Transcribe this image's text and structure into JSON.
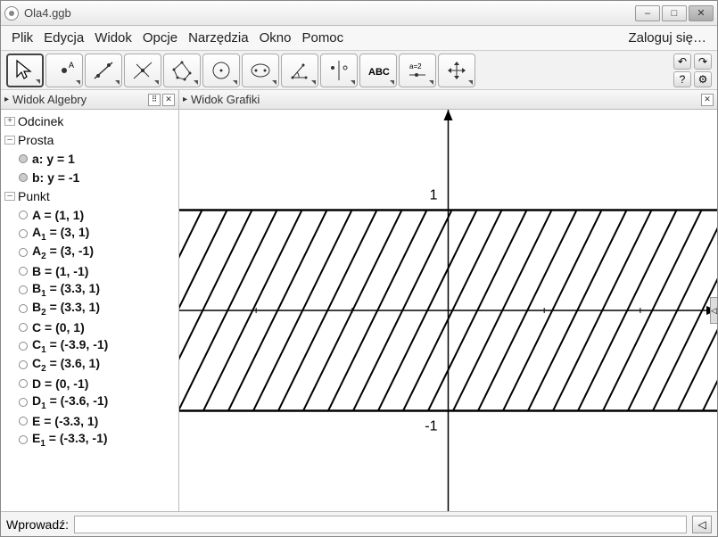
{
  "window": {
    "title": "Ola4.ggb"
  },
  "menu": {
    "items": [
      "Plik",
      "Edycja",
      "Widok",
      "Opcje",
      "Narzędzia",
      "Okno",
      "Pomoc"
    ],
    "login": "Zaloguj się…"
  },
  "panels": {
    "algebra_title": "Widok Algebry",
    "graphics_title": "Widok Grafiki"
  },
  "algebra": {
    "categories": [
      {
        "name": "Odcinek",
        "expanded": false,
        "children": []
      },
      {
        "name": "Prosta",
        "expanded": true,
        "children": [
          {
            "type": "line",
            "label": "a: y = 1"
          },
          {
            "type": "line",
            "label": "b: y = -1"
          }
        ]
      },
      {
        "name": "Punkt",
        "expanded": true,
        "children": [
          {
            "type": "point",
            "label": "A = (1, 1)"
          },
          {
            "type": "point",
            "label": "A₁ = (3, 1)"
          },
          {
            "type": "point",
            "label": "A₂ = (3, -1)"
          },
          {
            "type": "point",
            "label": "B = (1, -1)"
          },
          {
            "type": "point",
            "label": "B₁ = (3.3, 1)"
          },
          {
            "type": "point",
            "label": "B₂ = (3.3, 1)"
          },
          {
            "type": "point",
            "label": "C = (0, 1)"
          },
          {
            "type": "point",
            "label": "C₁ = (-3.9, -1)"
          },
          {
            "type": "point",
            "label": "C₂ = (3.6, 1)"
          },
          {
            "type": "point",
            "label": "D = (0, -1)"
          },
          {
            "type": "point",
            "label": "D₁ = (-3.6, -1)"
          },
          {
            "type": "point",
            "label": "E = (-3.3, 1)"
          },
          {
            "type": "point",
            "label": "E₁ = (-3.3, -1)"
          }
        ]
      }
    ]
  },
  "chart_data": {
    "type": "plot",
    "title": "",
    "xrange": [
      -2.8,
      2.8
    ],
    "yrange": [
      -2.0,
      2.0
    ],
    "xticks": [
      -2,
      -1,
      0,
      1,
      2
    ],
    "yticks": [
      -1,
      1
    ],
    "ytick_labels": {
      "1": "1",
      "-1": "-1"
    },
    "lines": [
      {
        "name": "a",
        "equation": "y = 1",
        "y": 1
      },
      {
        "name": "b",
        "equation": "y = -1",
        "y": -1
      }
    ],
    "hatched_region": {
      "ymin": -1,
      "ymax": 1,
      "style": "diagonal"
    }
  },
  "inputbar": {
    "label": "Wprowadź:",
    "value": "",
    "placeholder": ""
  },
  "icons": {
    "undo": "↶",
    "redo": "↷",
    "help": "?",
    "settings": "⚙",
    "min": "–",
    "max": "□",
    "close": "✕",
    "go": "◁"
  }
}
